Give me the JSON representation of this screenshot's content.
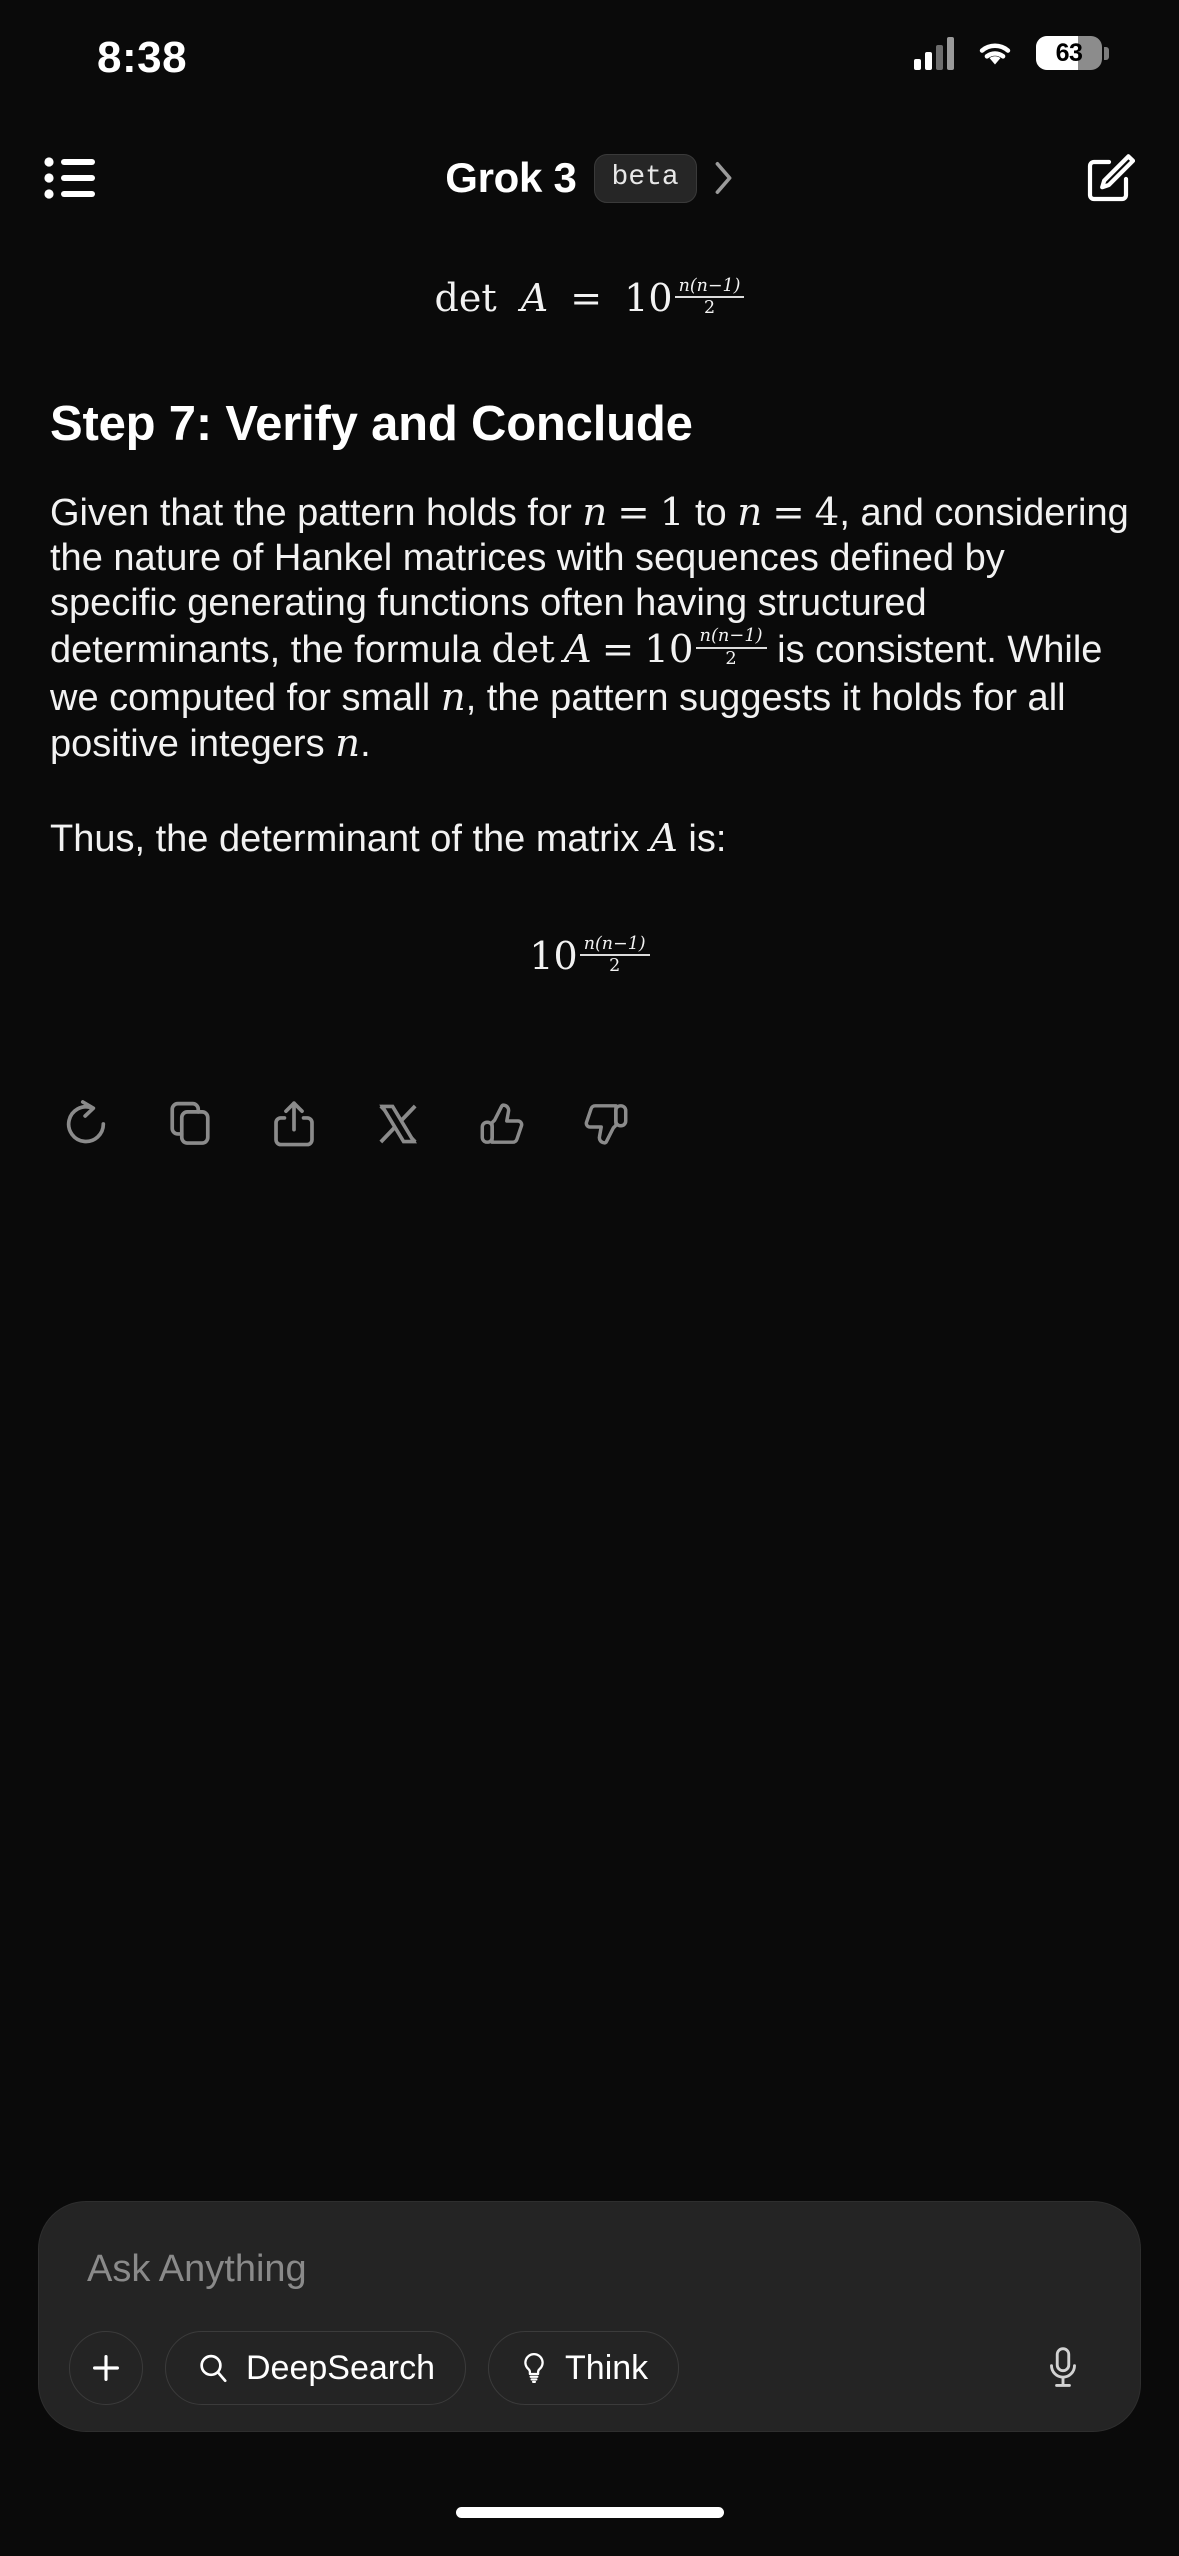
{
  "status_bar": {
    "time": "8:38",
    "battery_percent": "63",
    "battery_level": 63,
    "icons": [
      "cellular-signal-icon",
      "wifi-icon",
      "battery-icon"
    ]
  },
  "nav_bar": {
    "menu_icon": "list-icon",
    "title": "Grok 3",
    "badge": "beta",
    "chevron": "chevron-right-icon",
    "compose_icon": "compose-icon"
  },
  "message": {
    "top_equation": {
      "lhs": "det",
      "matrix": "A",
      "equals": "=",
      "base": "10",
      "exp_numerator": "n(n−1)",
      "exp_denominator": "2",
      "plain": "det A = 10^(n(n−1)/2)"
    },
    "heading": "Step 7: Verify and Conclude",
    "paragraph1": {
      "part1": "Given that the pattern holds for ",
      "math1_var": "n",
      "math1_eq": "=",
      "math1_val": "1",
      "part2": " to ",
      "math2_var": "n",
      "math2_eq": "=",
      "math2_val": "4",
      "part3": ", and considering the nature of Hankel matrices with sequences defined by specific generating functions often having structured determinants, the formula ",
      "inline_det": "det",
      "inline_matrix": "A",
      "inline_equals": "=",
      "inline_base": "10",
      "inline_num": "n(n−1)",
      "inline_den": "2",
      "part4": " is consistent. While we computed for small ",
      "math3_var": "n",
      "part5": ", the pattern suggests it holds for all positive integers ",
      "math4_var": "n",
      "part6": "."
    },
    "paragraph2": {
      "part1": "Thus, the determinant of the matrix ",
      "math_var": "A",
      "part2": " is:"
    },
    "final_equation": {
      "base": "10",
      "exp_numerator": "n(n−1)",
      "exp_denominator": "2",
      "plain": "10^(n(n−1)/2)"
    }
  },
  "actions": [
    {
      "name": "regenerate-button",
      "icon": "refresh-icon"
    },
    {
      "name": "copy-button",
      "icon": "copy-icon"
    },
    {
      "name": "share-button",
      "icon": "share-icon"
    },
    {
      "name": "post-to-x-button",
      "icon": "x-logo-icon"
    },
    {
      "name": "thumbs-up-button",
      "icon": "thumbs-up-icon"
    },
    {
      "name": "thumbs-down-button",
      "icon": "thumbs-down-icon"
    }
  ],
  "composer": {
    "placeholder": "Ask Anything",
    "attach_label": "+",
    "deepsearch_label": "DeepSearch",
    "think_label": "Think",
    "mic_icon": "microphone-icon"
  },
  "colors": {
    "background": "#0a0a0a",
    "composer_bg": "#242424",
    "badge_bg": "#262626",
    "text_primary": "#f2f2f2",
    "text_muted": "#8a8a8a",
    "icon_muted": "#8b8b8b"
  }
}
